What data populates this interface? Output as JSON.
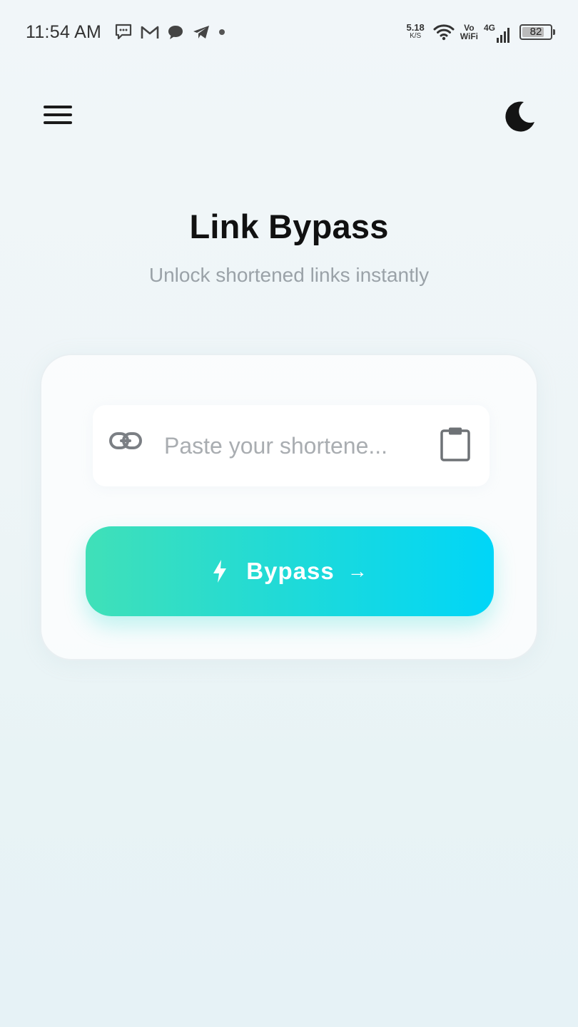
{
  "status_bar": {
    "time": "11:54 AM",
    "net_speed_value": "5.18",
    "net_speed_unit": "K/S",
    "vo_label": "Vo",
    "wifi_label": "WiFi",
    "network_type": "4G",
    "battery_level": "82",
    "notification_icons": [
      "chat-bubble-icon",
      "gmail-icon",
      "message-icon",
      "telegram-icon",
      "dot-icon"
    ]
  },
  "header": {
    "menu_icon": "hamburger-menu-icon",
    "theme_icon": "moon-icon"
  },
  "hero": {
    "title": "Link Bypass",
    "subtitle": "Unlock shortened links instantly"
  },
  "form": {
    "input_placeholder": "Paste your shortene...",
    "input_value": "",
    "link_icon": "link-icon",
    "paste_icon": "clipboard-icon",
    "button_label": "Bypass",
    "button_arrow": "→",
    "button_icon": "lightning-icon"
  },
  "colors": {
    "button_gradient_start": "#40e0b8",
    "button_gradient_end": "#00d6f8",
    "title": "#111111",
    "subtitle": "#9aa2a8"
  }
}
